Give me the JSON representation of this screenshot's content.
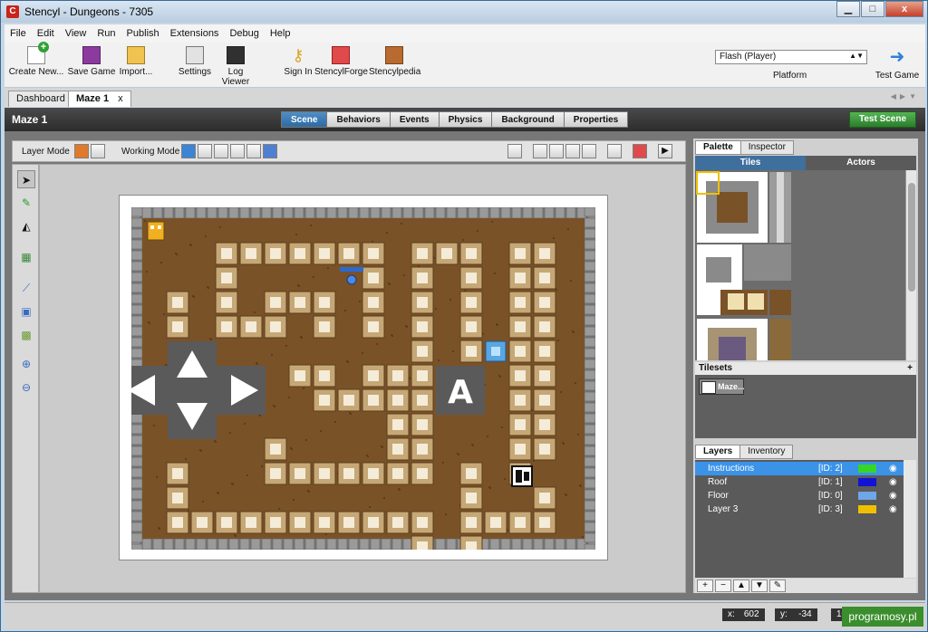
{
  "window": {
    "title": "Stencyl - Dungeons - 7305",
    "app_icon": "C",
    "min": "▁",
    "max": "□",
    "close": "x"
  },
  "menu": [
    "File",
    "Edit",
    "View",
    "Run",
    "Publish",
    "Extensions",
    "Debug",
    "Help"
  ],
  "toolbar": {
    "create": "Create New...",
    "save": "Save Game",
    "import": "Import...",
    "settings": "Settings",
    "log": "Log Viewer",
    "signin": "Sign In",
    "forge": "StencylForge",
    "pedia": "Stencylpedia",
    "platform_value": "Flash (Player)",
    "platform_label": "Platform",
    "test_game": "Test Game"
  },
  "doc_tabs": {
    "dashboard": "Dashboard",
    "maze": "Maze 1",
    "close": "x"
  },
  "scene": {
    "title": "Maze 1",
    "tabs": [
      "Scene",
      "Behaviors",
      "Events",
      "Physics",
      "Background",
      "Properties"
    ],
    "test_scene": "Test Scene"
  },
  "modes": {
    "layer": "Layer Mode",
    "working": "Working Mode"
  },
  "palette": {
    "tabs": [
      "Palette",
      "Inspector"
    ],
    "subtabs": [
      "Tiles",
      "Actors"
    ],
    "tilesets_label": "Tilesets",
    "tileset_name": "Maze..."
  },
  "layers": {
    "tabs": [
      "Layers",
      "Inventory"
    ],
    "rows": [
      {
        "name": "Instructions",
        "id": "[ID: 2]",
        "color": "#35d627"
      },
      {
        "name": "Roof",
        "id": "[ID: 1]",
        "color": "#1212d6"
      },
      {
        "name": "Floor",
        "id": "[ID: 0]",
        "color": "#6ea7e6"
      },
      {
        "name": "Layer 3",
        "id": "[ID: 3]",
        "color": "#f0c000"
      }
    ]
  },
  "status": {
    "x_label": "x:",
    "x": "602",
    "y_label": "y:",
    "y": "-34",
    "zoom": "100"
  },
  "watermark": "programosy.pl",
  "colors": {
    "accent": "#3b93e8",
    "floor": "#7a5228",
    "green": "#35a835"
  }
}
